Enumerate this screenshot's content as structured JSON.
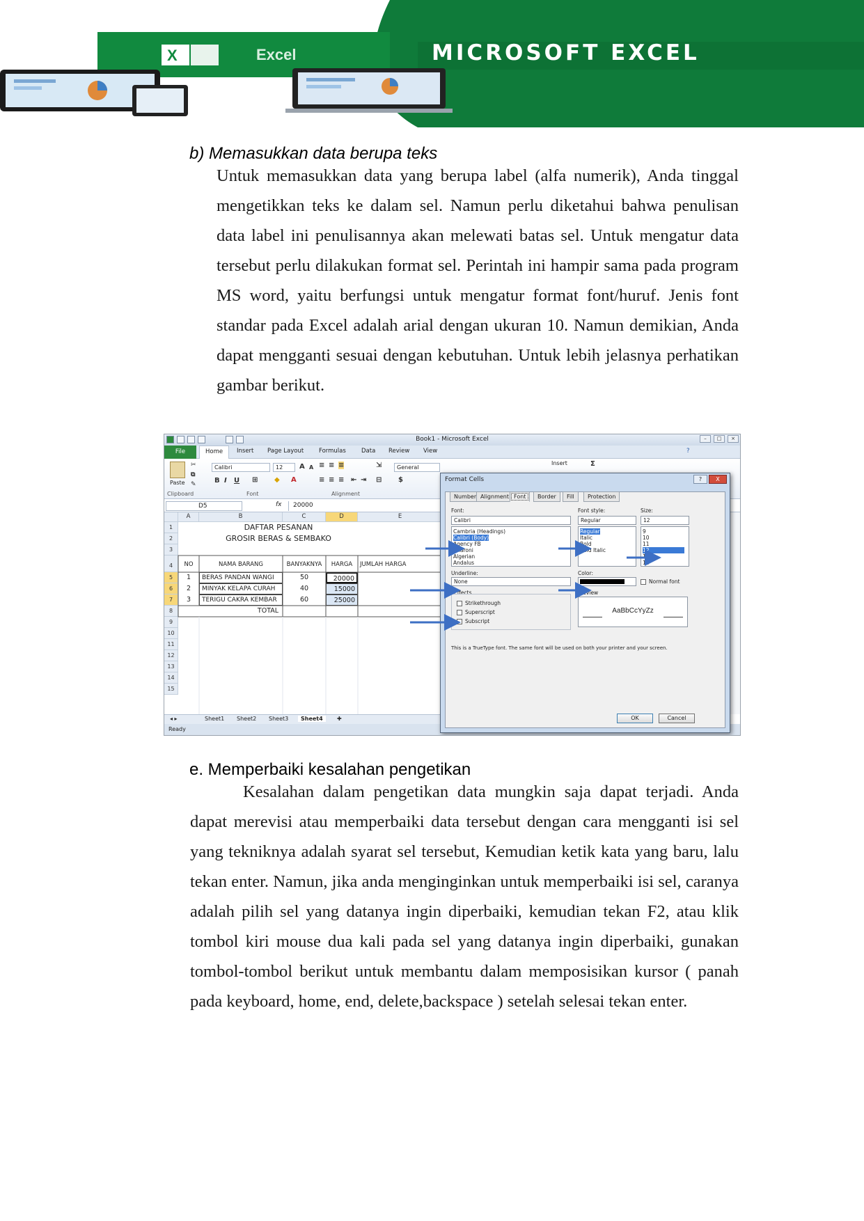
{
  "banner": {
    "title": "MICROSOFT EXCEL",
    "logo_word": "Excel",
    "colors": {
      "green": "#107c3a",
      "dark_green": "#0b6a30"
    }
  },
  "section_b": {
    "heading": "b)  Memasukkan data berupa teks",
    "paragraph": "Untuk memasukkan data yang berupa label (alfa numerik), Anda tinggal mengetikkan teks ke dalam sel. Namun perlu diketahui bahwa penulisan data label ini penulisannya akan melewati batas sel. Untuk mengatur data tersebut perlu dilakukan format sel. Perintah ini hampir sama pada program MS word, yaitu berfungsi untuk mengatur format font/huruf. Jenis font standar pada Excel adalah arial dengan ukuran 10. Namun demikian, Anda dapat mengganti sesuai dengan kebutuhan. Untuk lebih jelasnya perhatikan gambar berikut."
  },
  "excel": {
    "window_title": "Book1 - Microsoft Excel",
    "tabs": [
      "File",
      "Home",
      "Insert",
      "Page Layout",
      "Formulas",
      "Data",
      "Review",
      "View"
    ],
    "ribbon": {
      "paste": "Paste",
      "clipboard": "Clipboard",
      "font_name": "Calibri",
      "font_size": "12",
      "font_group": "Font",
      "alignment_group": "Alignment",
      "number_format": "General",
      "insert": "Insert",
      "bold": "B",
      "italic": "I",
      "underline": "U"
    },
    "name_box": "D5",
    "fx": "fx",
    "formula": "20000",
    "columns": [
      "A",
      "B",
      "C",
      "D",
      "E"
    ],
    "rows": [
      "1",
      "2",
      "3",
      "4",
      "5",
      "6",
      "7",
      "8",
      "9",
      "10",
      "11",
      "12",
      "13",
      "14",
      "15"
    ],
    "sheet": {
      "title1": "DAFTAR PESANAN",
      "title2": "GROSIR BERAS & SEMBAKO",
      "headers": [
        "NO",
        "NAMA BARANG",
        "BANYAKNYA",
        "HARGA",
        "JUMLAH HARGA"
      ],
      "data_rows": [
        [
          "1",
          "BERAS PANDAN WANGI",
          "50",
          "20000"
        ],
        [
          "2",
          "MINYAK KELAPA CURAH",
          "40",
          "15000"
        ],
        [
          "3",
          "TERIGU CAKRA KEMBAR",
          "60",
          "25000"
        ]
      ],
      "total": "TOTAL"
    },
    "sheet_tabs": [
      "Sheet1",
      "Sheet2",
      "Sheet3",
      "Sheet4"
    ],
    "status": "Ready",
    "dialog": {
      "title": "Format Cells",
      "help": "?",
      "close": "X",
      "tabs": [
        "Number",
        "Alignment",
        "Font",
        "Border",
        "Fill",
        "Protection"
      ],
      "font_label": "Font:",
      "font_value": "Calibri",
      "font_list": [
        "Cambria (Headings)",
        "Calibri (Body)",
        "Agency FB",
        "Aharoni",
        "Algerian",
        "Andalus"
      ],
      "style_label": "Font style:",
      "style_value": "Regular",
      "style_list": [
        "Regular",
        "Italic",
        "Bold",
        "Bold Italic"
      ],
      "size_label": "Size:",
      "size_value": "12",
      "size_list": [
        "9",
        "10",
        "11",
        "12",
        "14",
        "16"
      ],
      "underline_label": "Underline:",
      "underline_value": "None",
      "color_label": "Color:",
      "normal_font": "Normal font",
      "effects_label": "Effects",
      "effects": [
        "Strikethrough",
        "Superscript",
        "Subscript"
      ],
      "preview_label": "Preview",
      "preview_text": "AaBbCcYyZz",
      "note": "This is a TrueType font. The same font will be used on both your printer and your screen.",
      "ok": "OK",
      "cancel": "Cancel"
    },
    "arrow_color": "#3d6fc4"
  },
  "section_e": {
    "heading": "e.   Memperbaiki kesalahan pengetikan",
    "paragraph": "Kesalahan dalam pengetikan data mungkin saja dapat terjadi. Anda dapat merevisi atau memperbaiki data tersebut dengan cara mengganti isi sel yang tekniknya adalah syarat sel tersebut, Kemudian ketik kata yang baru, lalu tekan enter. Namun, jika anda menginginkan untuk memperbaiki isi sel, caranya adalah pilih sel yang datanya ingin diperbaiki, kemudian tekan F2, atau klik tombol kiri mouse dua kali pada sel yang datanya ingin diperbaiki, gunakan tombol-tombol berikut untuk membantu dalam memposisikan kursor ( panah pada keyboard, home, end, delete,backspace ) setelah selesai tekan enter."
  }
}
